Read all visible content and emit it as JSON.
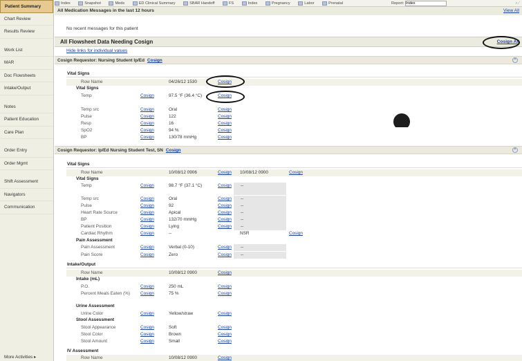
{
  "sidebar": {
    "items": [
      "Patient Summary",
      "Chart Review",
      "Results Review",
      "Work List",
      "MAR",
      "Doc Flowsheets",
      "Intake/Output",
      "Notes",
      "Patient Education",
      "Care Plan",
      "Order Entry",
      "Order Mgmt",
      "Shift Assessment",
      "Navigators",
      "Communication"
    ],
    "more": "More Activities ▸"
  },
  "toolbar": {
    "items": [
      "Index",
      "Snapshot",
      "Meds",
      "ED Clinical Summary",
      "SBAR Handoff",
      "FS",
      "Index",
      "Pregnancy",
      "Labor",
      "Prenatal"
    ],
    "report_label": "Report:",
    "report_value": "Index"
  },
  "messages": {
    "header": "All Medication Messages in the last 12 hours",
    "view_all": "View All",
    "none": "No recent messages for this patient"
  },
  "flowsheet": {
    "title": "All Flowsheet Data Needing Cosign",
    "cosign_all": "Cosign All",
    "hide_links": "Hide links for individual values"
  },
  "labels": {
    "cosign": "Cosign",
    "vital_signs": "Vital Signs",
    "pain_assessment": "Pain Assessment",
    "intake_output": "Intake/Output",
    "intake_ml": "Intake (mL)",
    "urine_assessment": "Urine Assessment",
    "stool_assessment": "Stool Assessment",
    "iv_assessment": "IV Assessment",
    "row_name": "Row Name"
  },
  "req1": {
    "title": "Cosign Requestor: Nursing Student Ip/Ed",
    "date": "04/26/12 1530",
    "rows": [
      {
        "name": "Temp",
        "value": "97.5 °F (36.4 °C)"
      },
      {
        "name": "Temp src",
        "value": "Oral"
      },
      {
        "name": "Pulse",
        "value": "122"
      },
      {
        "name": "Resp",
        "value": "16"
      },
      {
        "name": "SpO2",
        "value": "94 %"
      },
      {
        "name": "BP",
        "value": "130/78 mmHg"
      }
    ]
  },
  "req2": {
    "title": "Cosign Requestor: Ip/Ed Nursing Student Test, SN",
    "date1": "10/08/12 0906",
    "date2": "10/08/12 0900",
    "dash": "--",
    "vitals": [
      {
        "name": "Temp",
        "value": "98.7 °F (37.1 °C)"
      },
      {
        "name": "Temp src",
        "value": "Oral"
      },
      {
        "name": "Pulse",
        "value": "92"
      },
      {
        "name": "Heart Rate Source",
        "value": "Apical"
      },
      {
        "name": "BP",
        "value": "132/70 mmHg"
      },
      {
        "name": "Patient Position",
        "value": "Lying"
      },
      {
        "name": "Cardiac Rhythm",
        "value": "--",
        "value2": "NSR"
      }
    ],
    "pain": [
      {
        "name": "Pain Assessment",
        "value": "Verbal (0-10)"
      },
      {
        "name": "Pain Score",
        "value": "Zero"
      }
    ],
    "io_date": "10/08/12 0900",
    "intake": [
      {
        "name": "P.O.",
        "value": "250 mL"
      },
      {
        "name": "Percent Meals Eaten (%)",
        "value": "75 %"
      }
    ],
    "urine": [
      {
        "name": "Urine Color",
        "value": "Yellow/straw"
      }
    ],
    "stool": [
      {
        "name": "Stool Appearance",
        "value": "Soft"
      },
      {
        "name": "Stool Color",
        "value": "Brown"
      },
      {
        "name": "Stool Amount",
        "value": "Small"
      }
    ],
    "iv_date": "10/08/12 0900"
  }
}
